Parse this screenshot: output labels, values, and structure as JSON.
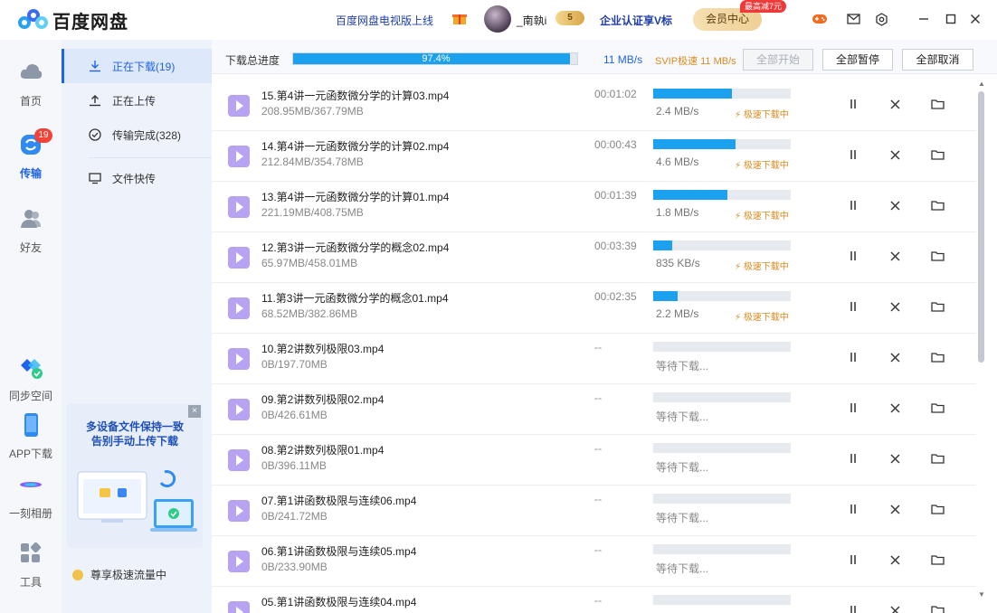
{
  "app": {
    "title": "百度网盘"
  },
  "header": {
    "tv_link": "百度网盘电视版上线",
    "username": "_南執i",
    "svip_badge": "5",
    "enterprise": "企业认证享V标",
    "vip_button": "会员中心",
    "promo": "最高减7元"
  },
  "left_nav": {
    "items": [
      {
        "label": "首页",
        "icon": "cloud-icon"
      },
      {
        "label": "传输",
        "icon": "transfer-icon",
        "badge": "19"
      },
      {
        "label": "好友",
        "icon": "friends-icon"
      },
      {
        "label": "同步空间",
        "icon": "sync-space-icon"
      },
      {
        "label": "APP下载",
        "icon": "phone-icon"
      },
      {
        "label": "一刻相册",
        "icon": "album-icon"
      },
      {
        "label": "工具",
        "icon": "tools-icon"
      }
    ]
  },
  "sub_nav": {
    "items": [
      {
        "label": "正在下载(19)",
        "icon": "download-icon",
        "active": true
      },
      {
        "label": "正在上传",
        "icon": "upload-icon"
      },
      {
        "label": "传输完成(328)",
        "icon": "check-circle-icon"
      },
      {
        "label": "文件快传",
        "icon": "monitor-icon"
      }
    ],
    "ad": {
      "line1": "多设备文件保持一致",
      "line2": "告别手动上传下载",
      "close": "×"
    },
    "speed_tip": "尊享极速流量中"
  },
  "toolbar": {
    "total_label": "下载总进度",
    "total_progress": 97.4,
    "total_percent_text": "97.4%",
    "speed": "11 MB/s",
    "svip_speed": "SVIP极速 11 MB/s",
    "start_all": "全部开始",
    "pause_all": "全部暂停",
    "cancel_all": "全部取消"
  },
  "downloads": [
    {
      "name": "15.第4讲一元函数微分学的计算03.mp4",
      "size": "208.95MB/367.79MB",
      "time": "00:01:02",
      "progress": 0.57,
      "speed": "2.4 MB/s",
      "fast": "极速下载中"
    },
    {
      "name": "14.第4讲一元函数微分学的计算02.mp4",
      "size": "212.84MB/354.78MB",
      "time": "00:00:43",
      "progress": 0.6,
      "speed": "4.6 MB/s",
      "fast": "极速下载中"
    },
    {
      "name": "13.第4讲一元函数微分学的计算01.mp4",
      "size": "221.19MB/408.75MB",
      "time": "00:01:39",
      "progress": 0.54,
      "speed": "1.8 MB/s",
      "fast": "极速下载中"
    },
    {
      "name": "12.第3讲一元函数微分学的概念02.mp4",
      "size": "65.97MB/458.01MB",
      "time": "00:03:39",
      "progress": 0.14,
      "speed": "835 KB/s",
      "fast": "极速下载中"
    },
    {
      "name": "11.第3讲一元函数微分学的概念01.mp4",
      "size": "68.52MB/382.86MB",
      "time": "00:02:35",
      "progress": 0.18,
      "speed": "2.2 MB/s",
      "fast": "极速下载中"
    },
    {
      "name": "10.第2讲数列极限03.mp4",
      "size": "0B/197.70MB",
      "time": "--",
      "progress": 0,
      "speed": "等待下载...",
      "fast": ""
    },
    {
      "name": "09.第2讲数列极限02.mp4",
      "size": "0B/426.61MB",
      "time": "--",
      "progress": 0,
      "speed": "等待下载...",
      "fast": ""
    },
    {
      "name": "08.第2讲数列极限01.mp4",
      "size": "0B/396.11MB",
      "time": "--",
      "progress": 0,
      "speed": "等待下载...",
      "fast": ""
    },
    {
      "name": "07.第1讲函数极限与连续06.mp4",
      "size": "0B/241.72MB",
      "time": "--",
      "progress": 0,
      "speed": "等待下载...",
      "fast": ""
    },
    {
      "name": "06.第1讲函数极限与连续05.mp4",
      "size": "0B/233.90MB",
      "time": "--",
      "progress": 0,
      "speed": "等待下载...",
      "fast": ""
    },
    {
      "name": "05.第1讲函数极限与连续04.mp4",
      "size": "",
      "time": "--",
      "progress": 0,
      "speed": "",
      "fast": ""
    }
  ],
  "colors": {
    "accent": "#1f64e8",
    "progress": "#1ba1ee",
    "fast": "#d98a1e",
    "badge": "#f44336"
  }
}
